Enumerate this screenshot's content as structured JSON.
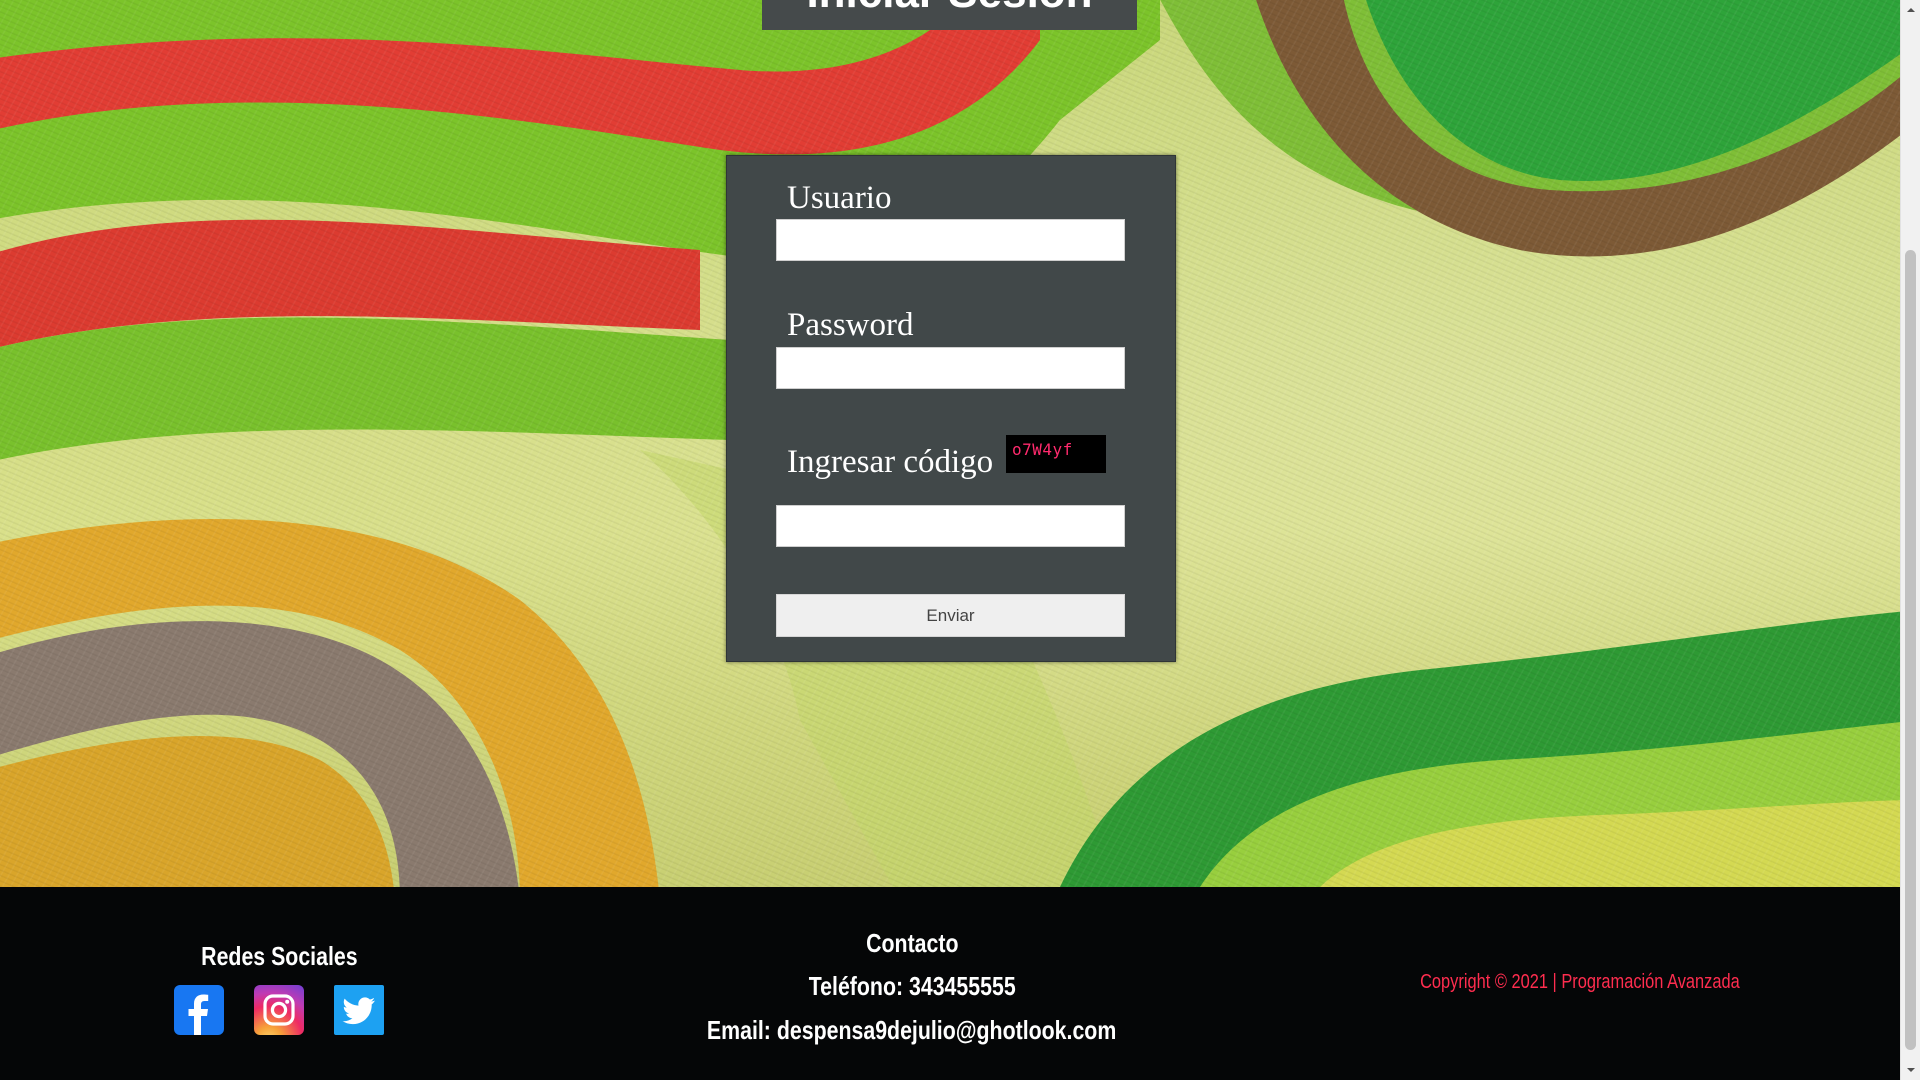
{
  "page": {
    "title": "Iniciar Sesión"
  },
  "login_form": {
    "username_label": "Usuario",
    "username_value": "",
    "password_label": "Password",
    "password_value": "",
    "captcha_label": "Ingresar código",
    "captcha_code": "o7W4yf",
    "captcha_value": "",
    "submit_label": "Enviar"
  },
  "footer": {
    "social": {
      "title": "Redes Sociales",
      "icons": [
        "facebook-icon",
        "instagram-icon",
        "twitter-icon"
      ]
    },
    "contact": {
      "title": "Contacto",
      "phone": "Teléfono: 343455555",
      "email": "Email: despensa9dejulio@ghotlook.com"
    },
    "copyright": "Copyright © 2021 | Programación Avanzada"
  },
  "colors": {
    "card_background": "#414849",
    "footer_background": "#050607",
    "copyright_text": "#ff2d4f",
    "captcha_text": "#ff2a6d",
    "facebook": "#1877f2",
    "twitter": "#1da1f2"
  }
}
